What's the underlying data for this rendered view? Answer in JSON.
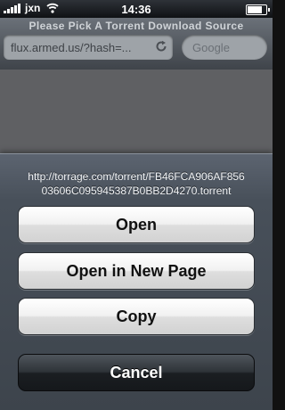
{
  "status_bar": {
    "carrier": "jxn",
    "time": "14:36",
    "battery_level": 0.8
  },
  "browser": {
    "page_title": "Please Pick A Torrent Download Source",
    "url": "flux.armed.us/?hash=...",
    "search_placeholder": "Google"
  },
  "action_sheet": {
    "url_line1": "http://torrage.com/torrent/FB46FCA906AF856",
    "url_line2": "03606C095945387B0BB2D4270.torrent",
    "buttons": {
      "open": "Open",
      "open_new_page": "Open in New Page",
      "copy": "Copy",
      "cancel": "Cancel"
    }
  },
  "colors": {
    "sheet_background": "#48505a",
    "light_button": "#f1f1f1",
    "dark_button": "#2e3338"
  }
}
